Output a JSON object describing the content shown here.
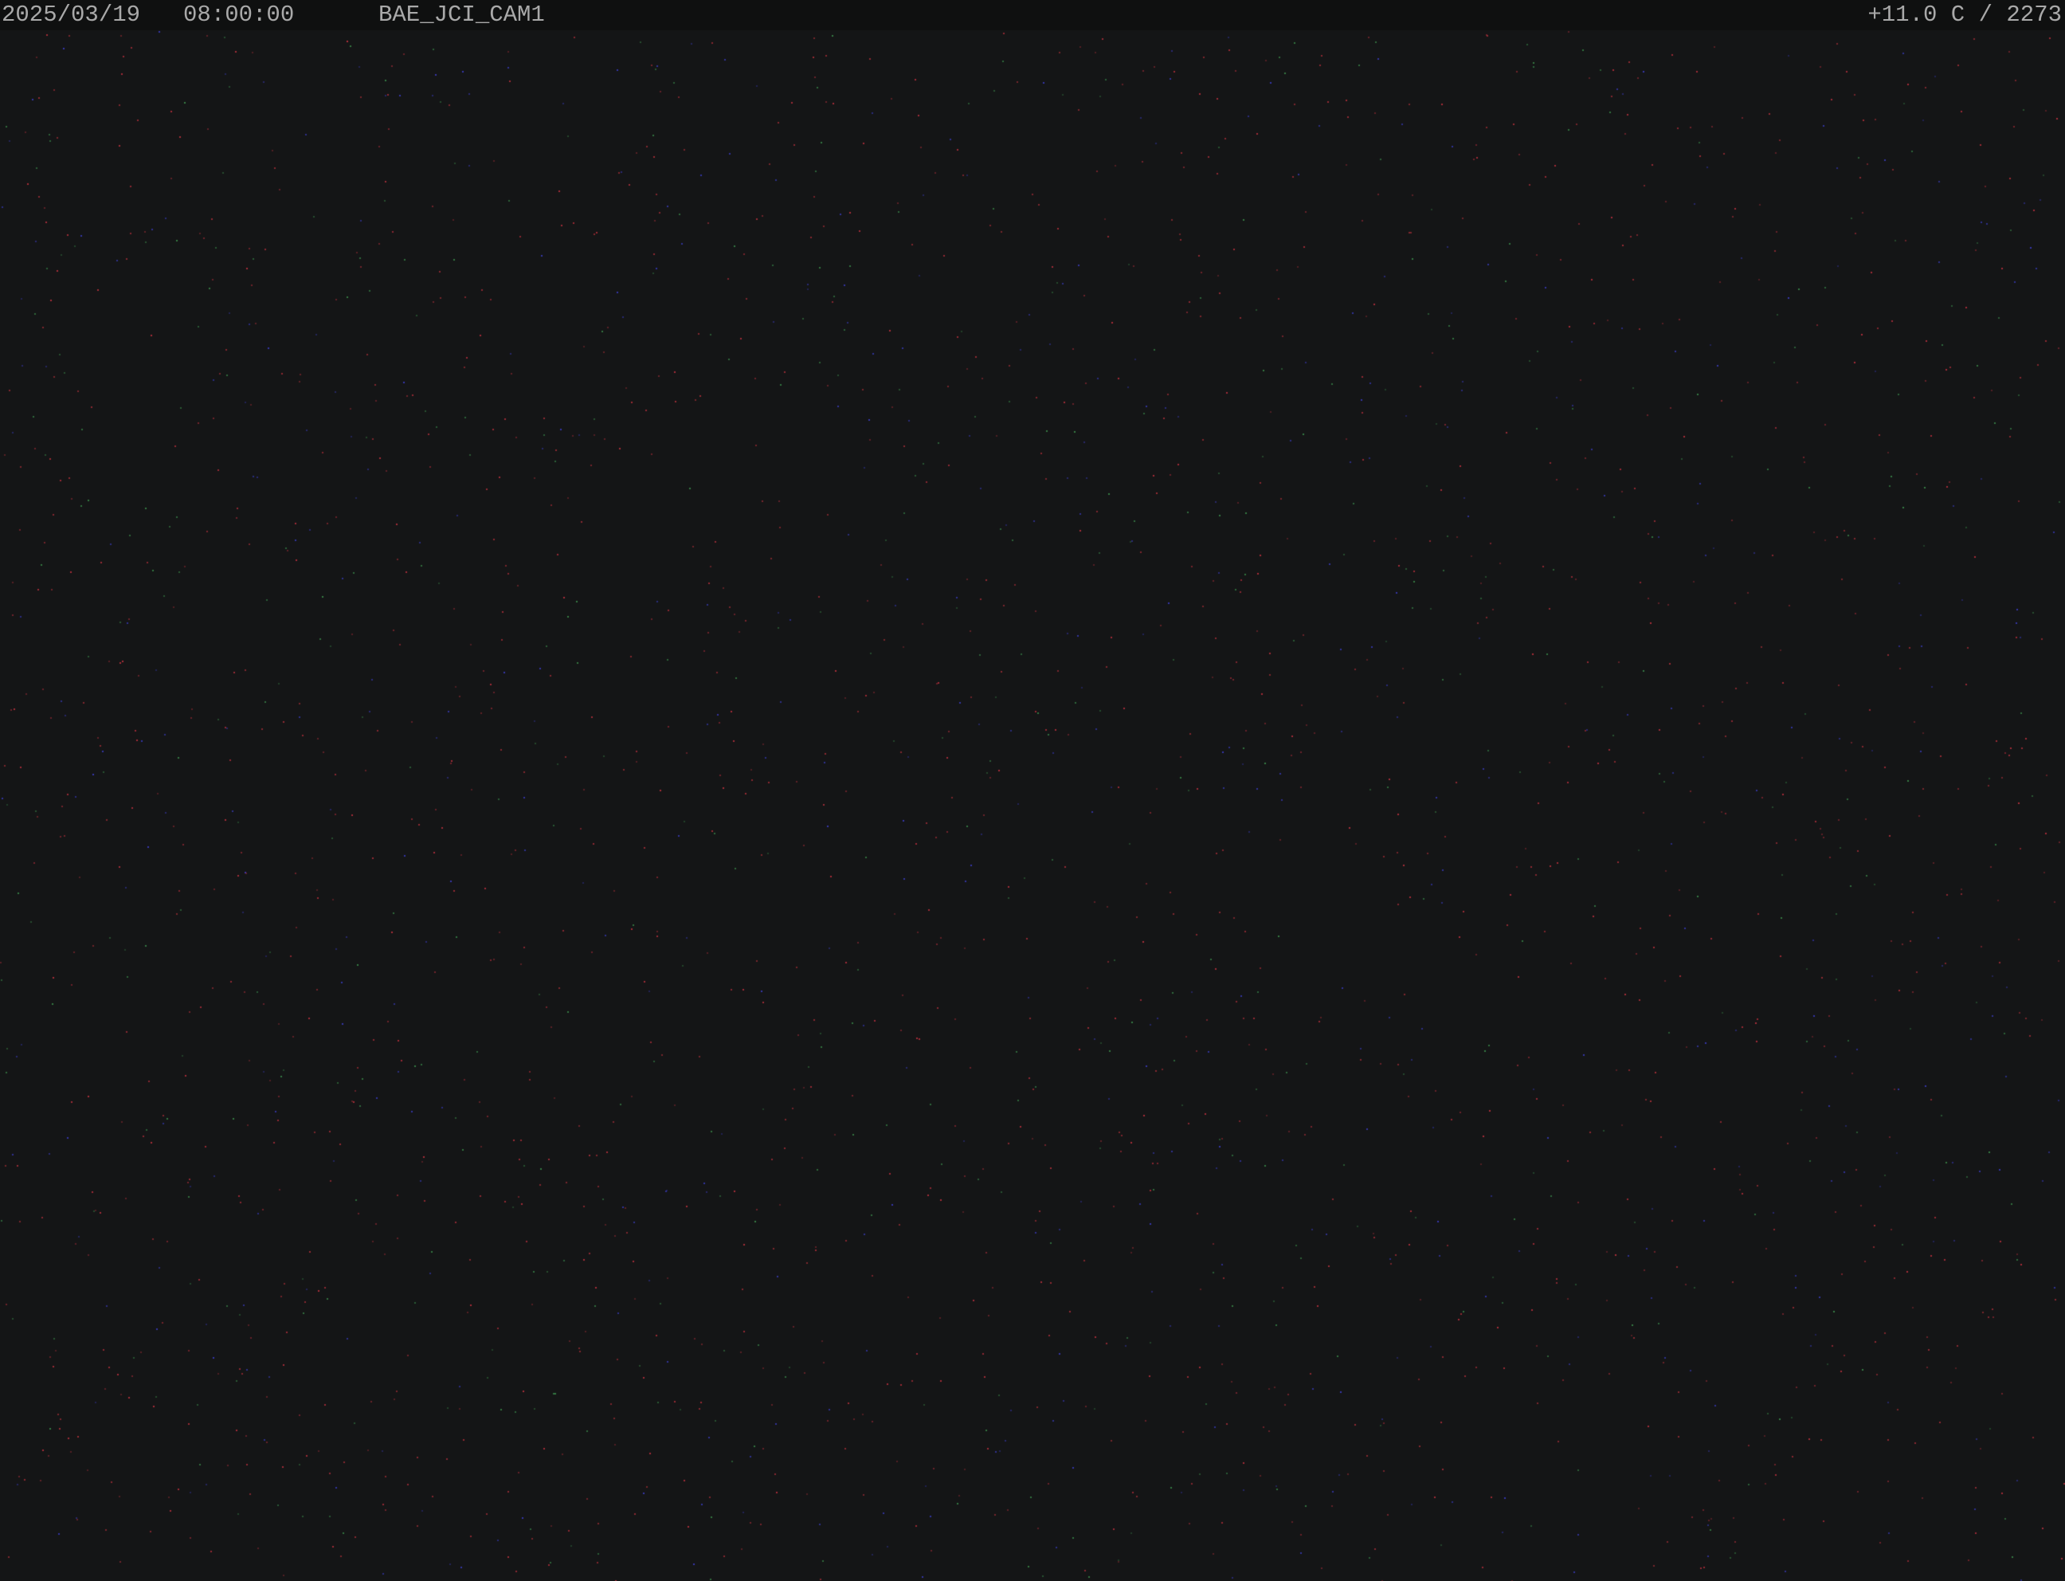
{
  "overlay": {
    "date": "2025/03/19",
    "time": "08:00:00",
    "camera_name": "BAE_JCI_CAM1",
    "temperature_altitude": "+11.0 C / 2273"
  },
  "colors": {
    "background": "#141516",
    "overlay_bar": "#0f1010",
    "overlay_text": "#a9a9a9",
    "noise_red": "#b8303c",
    "noise_blue": "#3a3cc0",
    "noise_green": "#3a8a4a"
  }
}
